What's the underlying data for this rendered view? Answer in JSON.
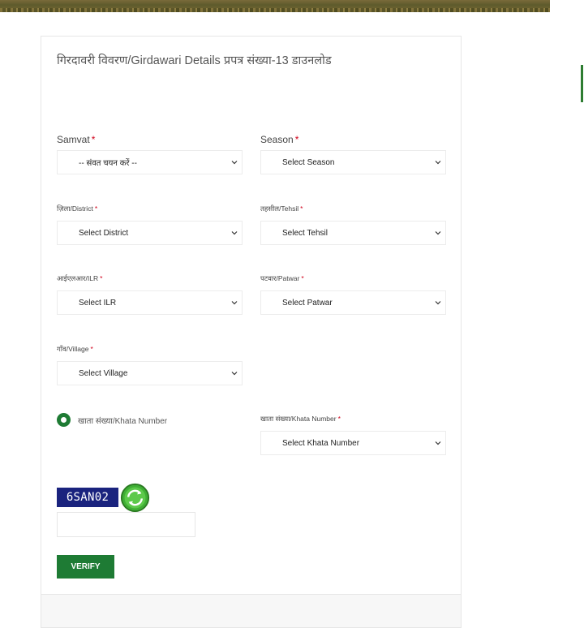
{
  "form": {
    "title": "गिरदावरी विवरण/Girdawari Details प्रपत्र संख्या-13 डाउनलोड",
    "required_mark": "*",
    "samvat": {
      "label": "Samvat",
      "value": "-- संवत चयन करें --"
    },
    "season": {
      "label": "Season",
      "value": "Select Season"
    },
    "district": {
      "label": "ज़िला/District",
      "value": "Select District"
    },
    "tehsil": {
      "label": "तहसील/Tehsil",
      "value": "Select Tehsil"
    },
    "ilr": {
      "label": "आईएलआर/ILR",
      "value": "Select ILR"
    },
    "patwar": {
      "label": "पटवार/Patwar",
      "value": "Select Patwar"
    },
    "village": {
      "label": "गाँव/Village",
      "value": "Select Village"
    },
    "khata_radio": {
      "label": "खाता संख्या/Khata Number",
      "checked": true
    },
    "khata": {
      "label": "खाता संख्या/Khata Number",
      "value": "Select Khata Number"
    },
    "captcha": {
      "code": "6SAN02",
      "input_value": ""
    },
    "verify_label": "VERIFY"
  },
  "icons": {
    "select_arrow": "chevron-down-icon",
    "captcha_refresh": "refresh-icon"
  },
  "colors": {
    "accent_green": "#1e7b34",
    "required_red": "#d0021b",
    "captcha_bg": "#1a237e"
  }
}
